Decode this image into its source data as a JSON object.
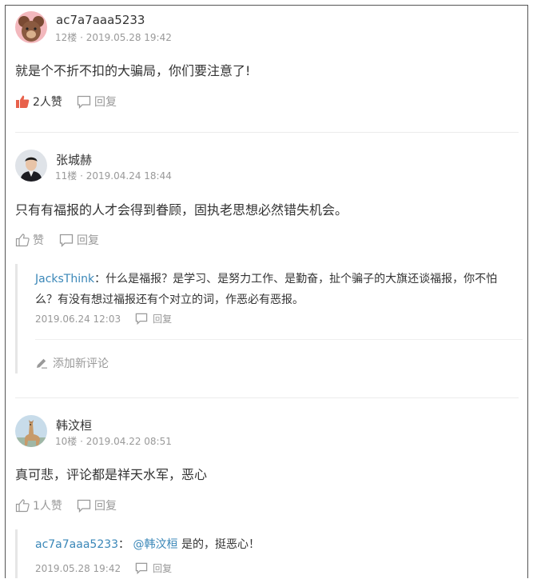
{
  "comments": [
    {
      "username": "ac7a7aaa5233",
      "floor": "12楼",
      "date": "2019.05.28 19:42",
      "content": "就是个不折不扣的大骗局，你们要注意了!",
      "like_label": "2人赞",
      "reply_label": "回复",
      "avatar_icon": "bear-avatar-icon"
    },
    {
      "username": "张城赫",
      "floor": "11楼",
      "date": "2019.04.24 18:44",
      "content": "只有有福报的人才会得到眷顾，固执老思想必然错失机会。",
      "like_label": "赞",
      "reply_label": "回复",
      "avatar_icon": "man-portrait-avatar-icon",
      "replies": [
        {
          "author": "JacksThink",
          "sep": "：",
          "line1": "什么是福报？是学习、是努力工作、是勤奋，扯个骗子的大旗还谈福报，你不怕",
          "line2": "么？有没有想过福报还有个对立的词，作恶必有恶报。",
          "date": "2019.06.24 12:03",
          "reply_label": "回复"
        }
      ],
      "add_comment_label": "添加新评论"
    },
    {
      "username": "韩汶桓",
      "floor": "10楼",
      "date": "2019.04.22 08:51",
      "content": "真可悲，评论都是祥天水军，恶心",
      "like_label": "1人赞",
      "reply_label": "回复",
      "avatar_icon": "llama-avatar-icon",
      "replies": [
        {
          "author": "ac7a7aaa5233",
          "sep": "：",
          "mention": "@韩汶桓",
          "text": "是的，挺恶心！",
          "date": "2019.05.28 19:42",
          "reply_label": "回复"
        }
      ]
    }
  ],
  "colors": {
    "link": "#3a87b8",
    "like_active": "#e8614b",
    "meta": "#999999"
  }
}
